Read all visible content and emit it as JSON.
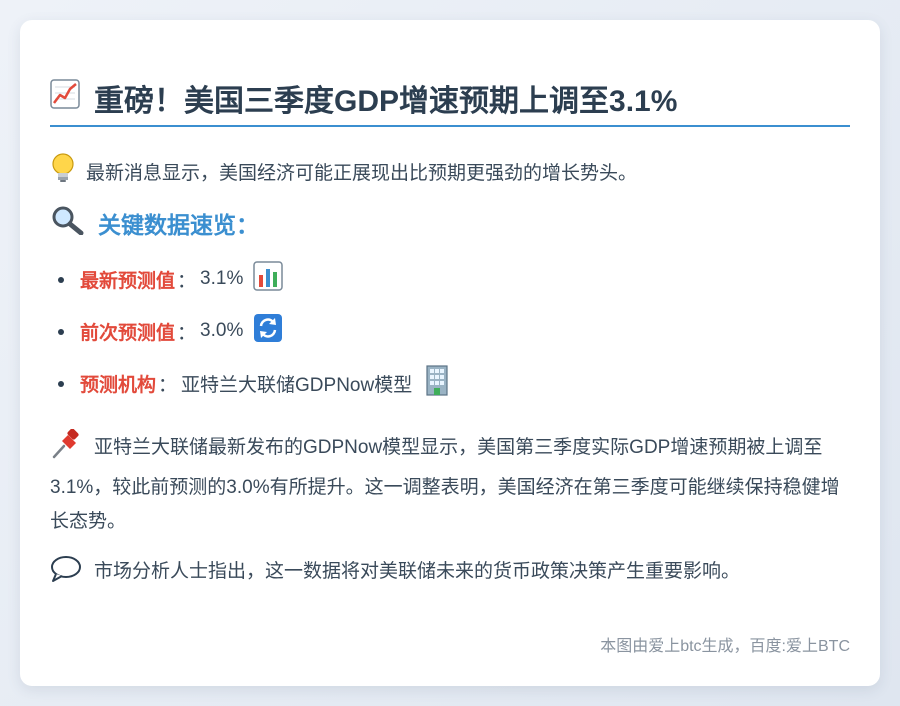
{
  "card": {
    "title": "重磅！美国三季度GDP增速预期上调至3.1%",
    "title_icon": "chart-increasing-icon",
    "lead": "最新消息显示，美国经济可能正展现出比预期更强劲的增长势头。",
    "lead_icon": "light-bulb-icon",
    "section_heading": "关键数据速览：",
    "section_icon": "magnifying-glass-icon",
    "separator": "：",
    "facts": [
      {
        "key": "最新预测值",
        "value": "3.1%",
        "icon": "bar-chart-icon"
      },
      {
        "key": "前次预测值",
        "value": "3.0%",
        "icon": "refresh-icon"
      },
      {
        "key": "预测机构",
        "value": "亚特兰大联储GDPNow模型",
        "icon": "office-building-icon"
      }
    ],
    "paragraph": "亚特兰大联储最新发布的GDPNow模型显示，美国第三季度实际GDP增速预期被上调至3.1%，较此前预测的3.0%有所提升。这一调整表明，美国经济在第三季度可能继续保持稳健增长态势。",
    "paragraph_icon": "pushpin-icon",
    "remark": "市场分析人士指出，这一数据将对美联储未来的货币政策决策产生重要影响。",
    "remark_icon": "speech-bubble-icon",
    "footer": "本图由爱上btc生成，百度:爱上BTC"
  },
  "colors": {
    "accent_blue": "#3b8fd0",
    "key_red": "#e24a3b",
    "text_dark": "#2c3e50"
  }
}
